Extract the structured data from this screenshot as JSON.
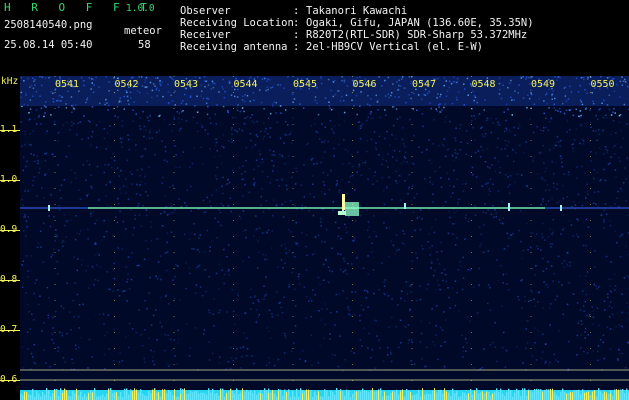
{
  "app": {
    "title": "H R O F F T",
    "version": "1.0.0"
  },
  "file": {
    "name": "2508140540.png",
    "date_time": "25.08.14 05:40"
  },
  "meteor": {
    "label": "meteor",
    "count": "58"
  },
  "info": [
    {
      "key": "Observer",
      "sep": ":",
      "value": "Takanori Kawachi"
    },
    {
      "key": "Receiving Location",
      "sep": ":",
      "value": "Ogaki, Gifu, JAPAN (136.60E, 35.35N)"
    },
    {
      "key": "Receiver",
      "sep": ":",
      "value": "R820T2(RTL-SDR) SDR-Sharp 53.372MHz"
    },
    {
      "key": "Receiving antenna",
      "sep": ":",
      "value": "2el-HB9CV Vertical (el. E-W)"
    }
  ],
  "axis": {
    "unit": "kHz",
    "y_labels": [
      "1.1",
      "1.0",
      "0.9",
      "0.8",
      "0.7",
      "0.6"
    ],
    "time_labels": [
      "0541",
      "0542",
      "0543",
      "0544",
      "0545",
      "0546",
      "0547",
      "0548",
      "0549",
      "0550"
    ]
  },
  "colors": {
    "background": "#000000",
    "spectrum_bg": "#000a28",
    "label_yellow": "#f4f25a",
    "text_cyan": "#7fe0f0",
    "carrier": "#7dff9a",
    "baseline": "#26d6f0"
  }
}
